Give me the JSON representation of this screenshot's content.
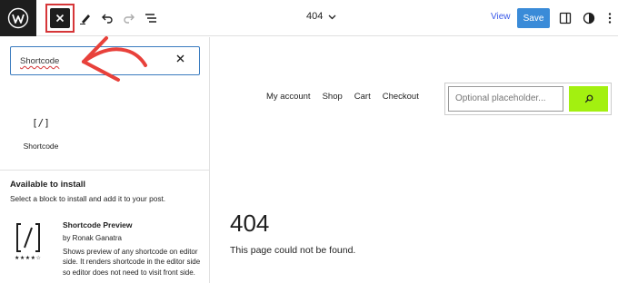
{
  "toolbar": {
    "document_title": "404",
    "view_label": "View",
    "save_label": "Save",
    "icons": [
      "wordpress-icon",
      "close-icon",
      "pencil-icon",
      "undo-icon",
      "redo-icon",
      "list-view-icon",
      "chevron-down-icon",
      "sidebar-icon",
      "styles-icon",
      "more-icon"
    ]
  },
  "inserter": {
    "search_value": "Shortcode",
    "result_block": {
      "glyph": "[/]",
      "label": "Shortcode"
    },
    "install_title": "Available to install",
    "install_subtitle": "Select a block to install and add it to your post.",
    "plugin": {
      "name": "Shortcode Preview",
      "author": "by Ronak Ganatra",
      "description": "Shows preview of any shortcode on editor side. It renders shortcode in the editor side so editor does not need to visit front side.",
      "rating": 4,
      "stars_display": "★★★★☆"
    }
  },
  "canvas": {
    "nav": [
      "My account",
      "Shop",
      "Cart",
      "Checkout"
    ],
    "search_placeholder": "Optional placeholder...",
    "heading": "404",
    "message": "This page could not be found."
  },
  "colors": {
    "accent": "#3a8bd8",
    "search_button": "#a3f010",
    "annotation": "#d63638"
  }
}
